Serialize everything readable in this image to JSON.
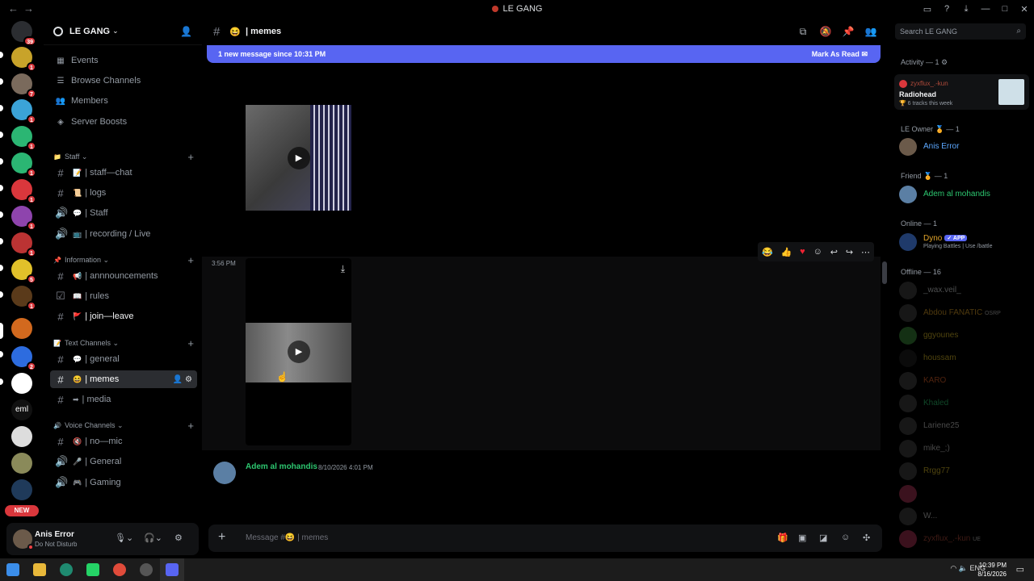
{
  "window": {
    "title": "LE GANG",
    "nav_back": "←",
    "nav_forward": "→"
  },
  "rail": {
    "dm_badge": "39",
    "badges": [
      "1",
      "7",
      "1",
      "1",
      "1",
      "1",
      "1",
      "1",
      "5",
      "1",
      "2"
    ],
    "text_server": "eml",
    "new_label": "NEW"
  },
  "guild": {
    "name": "LE GANG"
  },
  "nav": {
    "events": "Events",
    "browse": "Browse Channels",
    "members": "Members",
    "boosts": "Server Boosts"
  },
  "categories": {
    "staff": "Staff",
    "information": "Information",
    "text": "Text Channels",
    "voice": "Voice Channels"
  },
  "channels": {
    "staff_chat": "| staff—chat",
    "logs": "| logs",
    "staff": "| Staff",
    "recording": "| recording / Live",
    "announcements": "| annnouncements",
    "rules": "| rules",
    "join_leave": "| join—leave",
    "general": "| general",
    "memes": "| memes",
    "media": "| media",
    "no_mic": "| no—mic",
    "general_voice": "| General",
    "gaming": "| Gaming"
  },
  "user": {
    "name": "Anis Error",
    "status": "Do Not Disturb"
  },
  "chat": {
    "channel_name": "| memes",
    "search_placeholder": "Search LE GANG",
    "new_message": "1 new message since 10:31 PM",
    "mark_read": "Mark As Read",
    "timestamp": "3:56 PM",
    "author": "Adem al mohandis",
    "author_date": "8/10/2026 4:01 PM",
    "composer_placeholder": "Message #😆 | memes"
  },
  "members": {
    "activity_header": "Activity — 1",
    "activity_user": "zyxflux_.-kun",
    "activity_title": "Radiohead",
    "activity_sub": "6 tracks this week",
    "owner_header": "LE Owner 🏅 — 1",
    "friend_header": "Friend 🏅 — 1",
    "online_header": "Online — 1",
    "offline_header": "Offline — 16",
    "owner": "Anis Error",
    "friend": "Adem al mohandis",
    "bot": "Dyno",
    "bot_tag": "✓ APP",
    "bot_status": "Playing Battles | Use /battle",
    "offline_list": [
      "_wax.veil_",
      "Abdou FANATIC",
      "ggyounes",
      "houssam",
      "KARO",
      "Khaled",
      "Lariene25",
      "mike_;)",
      "Rrgg77",
      "",
      "W...",
      "zyxflux_.-kun"
    ],
    "offline_tags": {
      "abdou": "OSRP",
      "zyx": "UE"
    }
  },
  "taskbar": {
    "lang": "ENG",
    "time": "10:39 PM",
    "date": "8/16/2026"
  },
  "colors": {
    "accent": "#5865f2",
    "online_green": "#2dc770",
    "owner_blue": "#5ca8ff",
    "dnd_red": "#f23f43",
    "dyno_name": "#e0a32a"
  }
}
